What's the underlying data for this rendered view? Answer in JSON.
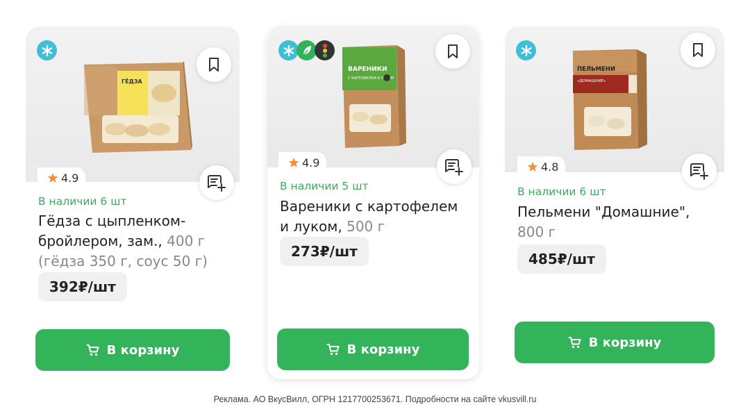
{
  "products": [
    {
      "rating": "4.9",
      "stock": "В наличии 6 шт",
      "title_line1": "Гёдза с цыпленком-",
      "title_line2": "бройлером, зам.,",
      "weight": "400 г",
      "title_line3": "(гёдза 350 г, соус 50 г)",
      "price": "392₽/шт",
      "cart_label": "В корзину",
      "package_label": "ГЁДЗА",
      "badges": [
        "snowflake-icon"
      ]
    },
    {
      "rating": "4.9",
      "stock": "В наличии 5 шт",
      "title_line1": "Вареники с картофелем",
      "title_line2": "и луком,",
      "weight": "500 г",
      "price": "273₽/шт",
      "cart_label": "В корзину",
      "package_label": "ВАРЕНИКИ",
      "package_sub": "С КАРТОФЕЛЕМ И ЛУКОМ",
      "badges": [
        "snowflake-icon",
        "leaf-icon",
        "traffic-light-icon"
      ]
    },
    {
      "rating": "4.8",
      "stock": "В наличии 6 шт",
      "title_line1": "Пельмени \"Домашние\",",
      "weight": "800 г",
      "price": "485₽/шт",
      "cart_label": "В корзину",
      "package_label": "ПЕЛЬМЕНИ",
      "package_sub": "«ДОМАШНИЕ»",
      "badges": [
        "snowflake-icon"
      ]
    }
  ],
  "footer": "Реклама. АО ВкусВилл, ОГРН 1217700253671. Подробности на сайте vkusvill.ru",
  "colors": {
    "green": "#33b35a",
    "stock_green": "#3aaa5c",
    "snow_blue": "#3fbfd6",
    "star": "#f0913a"
  }
}
